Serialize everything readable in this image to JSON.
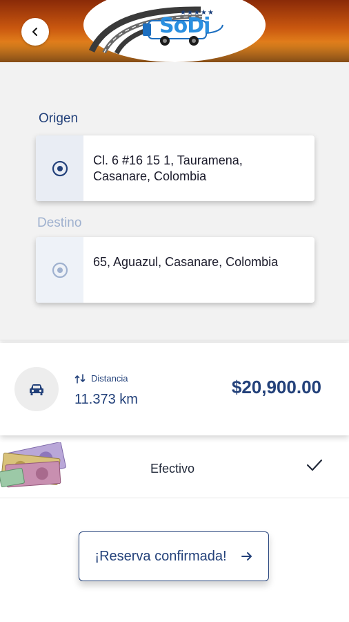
{
  "header": {
    "back_icon": "chevron-left-icon",
    "logo_text": "SoDi",
    "logo_stars": "★★★★★"
  },
  "trip": {
    "origin_label": "Origen",
    "origin_address": "Cl. 6 #16 15 1, Tauramena, Casanare, Colombia",
    "origin_icon": "radio-target-icon",
    "destination_label": "Destino",
    "destination_address": "65, Aguazul, Casanare, Colombia",
    "destination_icon": "radio-target-icon"
  },
  "summary": {
    "vehicle_icon": "car-icon",
    "distance_icon": "route-icon",
    "distance_label": "Distancia",
    "distance_value": "11.373 km",
    "price": "$20,900.00"
  },
  "payment": {
    "method_image": "cash-banknotes-image",
    "method_label": "Efectivo",
    "selected_icon": "checkmark-icon"
  },
  "action": {
    "confirm_label": "¡Reserva confirmada!",
    "confirm_icon": "arrow-right-icon"
  },
  "colors": {
    "primary": "#23417a",
    "muted": "#9fb1cf",
    "background": "#f2f2f2"
  }
}
